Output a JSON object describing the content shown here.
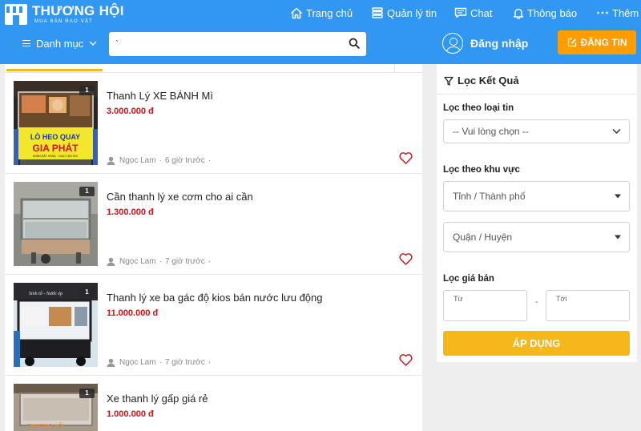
{
  "header": {
    "brand": "THƯƠNG HỘI",
    "tagline": "MUA BÁN RAO VẶT",
    "nav": [
      {
        "label": "Trang chủ",
        "icon": "home-icon"
      },
      {
        "label": "Quản lý tin",
        "icon": "list-icon"
      },
      {
        "label": "Chat",
        "icon": "chat-icon"
      },
      {
        "label": "Thông báo",
        "icon": "bell-icon"
      },
      {
        "label": "Thêm",
        "icon": "more-icon"
      }
    ],
    "category_label": "Danh mục",
    "search_value": "`",
    "login_label": "Đăng nhập",
    "post_label": "ĐĂNG TIN",
    "colors": {
      "primary": "#3097f3",
      "post_button": "#ff9c00",
      "accent": "#f6b71b",
      "price": "#c9141a"
    }
  },
  "listings": [
    {
      "title": "Thanh Lý XE BÁNH Mì",
      "price": "3.000.000 đ",
      "seller": "Ngọc Lam",
      "time": "6 giờ trước",
      "photo_count": "1",
      "thumb_text_1": "LÒ HEO QUAY",
      "thumb_text_2": "GIA PHÁT",
      "thumb_text_3": "NHẬN ĐẶT HÀNG · GIAO TẬN NƠI"
    },
    {
      "title": "Cần thanh lý xe cơm cho ai cần",
      "price": "1.300.000 đ",
      "seller": "Ngọc Lam",
      "time": "7 giờ trước",
      "photo_count": "1"
    },
    {
      "title": "Thanh lý xe ba gác độ kios bán nước lưu động",
      "price": "11.000.000 đ",
      "seller": "Ngọc Lam",
      "time": "7 giờ trước",
      "photo_count": "1",
      "thumb_text_1": "Sinh tố - Nước ép"
    },
    {
      "title": "Xe thanh lý gấp giá rẻ",
      "price": "1.000.000 đ",
      "seller": "",
      "time": "",
      "photo_count": "1",
      "thumb_text_1": "THƯƠNG HỘI"
    }
  ],
  "filter": {
    "title": "Lọc Kết Quả",
    "type_label": "Lọc theo loại tin",
    "type_placeholder": "-- Vui lòng chọn --",
    "area_label": "Lọc theo khu vực",
    "province_placeholder": "Tỉnh / Thành phố",
    "district_placeholder": "Quận / Huyện",
    "price_label": "Lọc giá bán",
    "price_from": "Từ",
    "price_sep": "-",
    "price_to": "Tới",
    "apply_label": "ÁP DỤNG"
  }
}
